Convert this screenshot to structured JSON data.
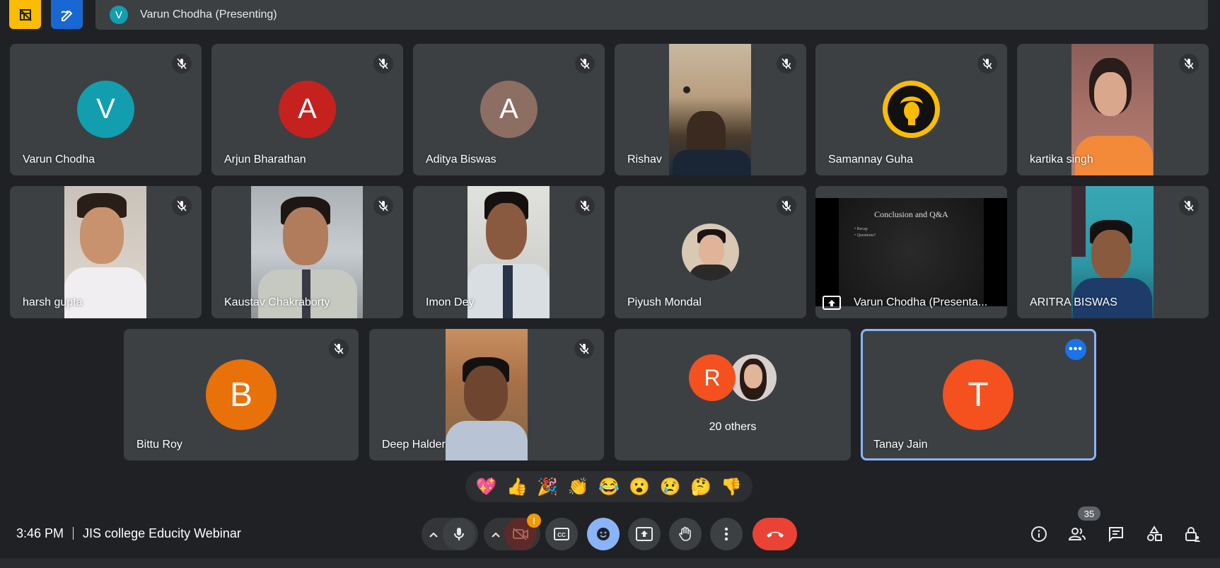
{
  "presenting_bar": {
    "avatar_letter": "V",
    "text": "Varun Chodha (Presenting)"
  },
  "tiles": {
    "varun": {
      "name": "Varun Chodha",
      "letter": "V"
    },
    "arjun": {
      "name": "Arjun Bharathan",
      "letter": "A"
    },
    "aditya": {
      "name": "Aditya Biswas",
      "letter": "A"
    },
    "rishav": {
      "name": "Rishav"
    },
    "samannay": {
      "name": "Samannay Guha"
    },
    "kartika": {
      "name": "kartika singh"
    },
    "harsh": {
      "name": "harsh gupta"
    },
    "kaustav": {
      "name": "Kaustav Chakraborty"
    },
    "imon": {
      "name": "Imon Dey"
    },
    "piyush": {
      "name": "Piyush Mondal"
    },
    "presentation": {
      "name": "Varun Chodha (Presenta...",
      "slide_title": "Conclusion and Q&A",
      "slide_bullets": [
        "Recap",
        "Questions?"
      ]
    },
    "aritra": {
      "name": "ARITRA BISWAS"
    },
    "bittu": {
      "name": "Bittu Roy",
      "letter": "B"
    },
    "deep": {
      "name": "Deep Halder"
    },
    "others": {
      "letter": "R",
      "label": "20 others"
    },
    "tanay": {
      "name": "Tanay Jain",
      "letter": "T"
    }
  },
  "reactions": [
    "💖",
    "👍",
    "🎉",
    "👏",
    "😂",
    "😮",
    "😢",
    "🤔",
    "👎"
  ],
  "bottom": {
    "time": "3:46 PM",
    "meeting_name": "JIS college Educity Webinar",
    "participant_count": "35"
  },
  "colors": {
    "accent": "#8ab4f8",
    "end_call": "#ea4335",
    "avatar_teal": "#129eaf",
    "avatar_rust": "#c5221f",
    "avatar_brown": "#8d6e63",
    "avatar_orange": "#e8710a",
    "avatar_red": "#f4511e"
  },
  "icons": {
    "top_left_1": "hide-tiles-icon",
    "top_left_2": "whiteboard-icon",
    "mic": "mic-off-icon",
    "more": "more-horiz-icon"
  }
}
